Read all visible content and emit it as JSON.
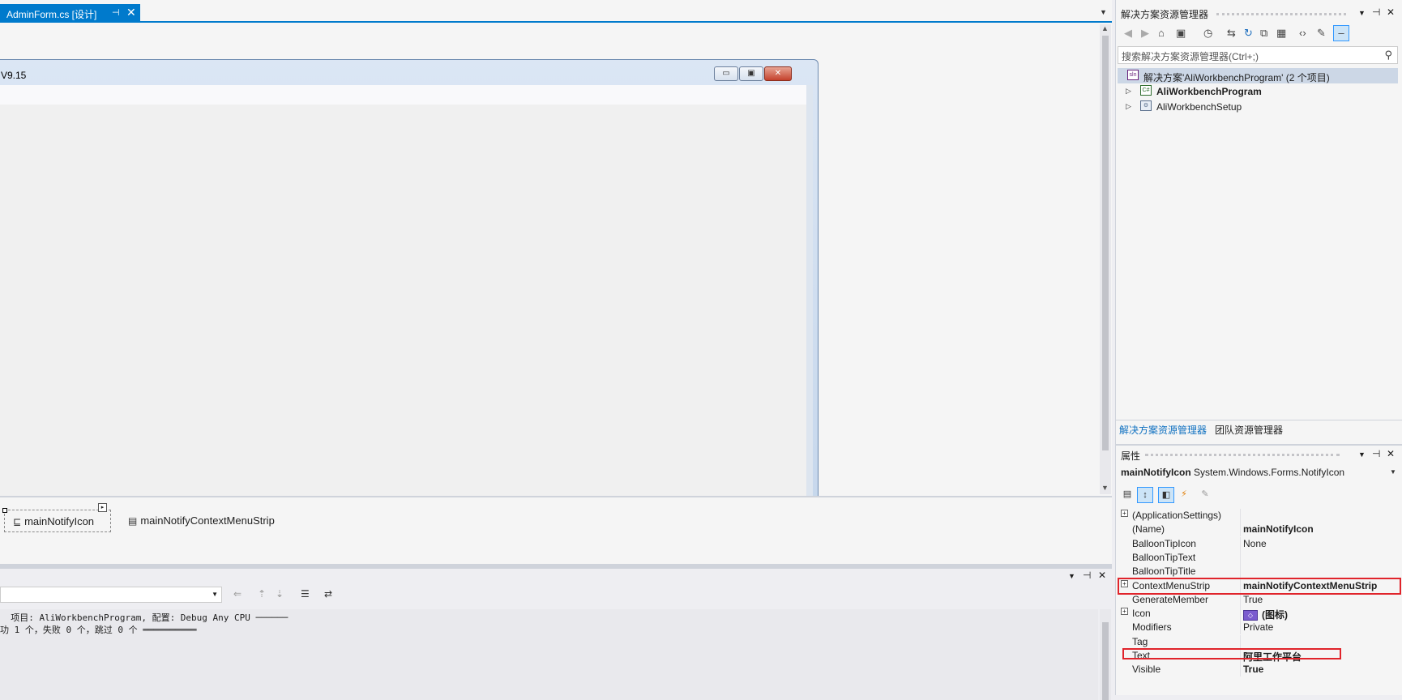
{
  "document_tab": {
    "title": "AdminForm.cs [设计]",
    "pin": "⊣",
    "close": "✕"
  },
  "form": {
    "title": "V9.15",
    "min": "▭",
    "max": "▣",
    "close": "✕"
  },
  "tray": {
    "items": [
      {
        "label": "mainNotifyIcon",
        "icon": "notify-icon"
      },
      {
        "label": "mainNotifyContextMenuStrip",
        "icon": "context-menu-icon"
      }
    ]
  },
  "output": {
    "combo_value": "",
    "lines": [
      "  项目: AliWorkbenchProgram, 配置: Debug Any CPU ──────",
      "功 1 个，失败 0 个，跳过 0 个 ══════════"
    ]
  },
  "solution_explorer": {
    "title": "解决方案资源管理器",
    "search_placeholder": "搜索解决方案资源管理器(Ctrl+;)",
    "tree": [
      {
        "label": "解决方案'AliWorkbenchProgram' (2 个项目)",
        "icon": "solution-icon",
        "icon_text": "sln"
      },
      {
        "label": "AliWorkbenchProgram",
        "icon": "csharp-project-icon",
        "icon_text": "C#"
      },
      {
        "label": "AliWorkbenchSetup",
        "icon": "setup-project-icon",
        "icon_text": "⚙"
      }
    ],
    "tabs": [
      "解决方案资源管理器",
      "团队资源管理器"
    ]
  },
  "properties": {
    "title": "属性",
    "object_name": "mainNotifyIcon",
    "object_type": "System.Windows.Forms.NotifyIcon",
    "rows": [
      {
        "name": "(ApplicationSettings)",
        "value": "",
        "expandable": true,
        "bold": false
      },
      {
        "name": "(Name)",
        "value": "mainNotifyIcon",
        "expandable": false,
        "bold": true
      },
      {
        "name": "BalloonTipIcon",
        "value": "None",
        "expandable": false,
        "bold": false
      },
      {
        "name": "BalloonTipText",
        "value": "",
        "expandable": false,
        "bold": false
      },
      {
        "name": "BalloonTipTitle",
        "value": "",
        "expandable": false,
        "bold": false
      },
      {
        "name": "ContextMenuStrip",
        "value": "mainNotifyContextMenuStrip",
        "expandable": true,
        "bold": true
      },
      {
        "name": "GenerateMember",
        "value": "True",
        "expandable": false,
        "bold": false
      },
      {
        "name": "Icon",
        "value": "(图标)",
        "expandable": true,
        "bold": true
      },
      {
        "name": "Modifiers",
        "value": "Private",
        "expandable": false,
        "bold": false
      },
      {
        "name": "Tag",
        "value": "",
        "expandable": false,
        "bold": false
      },
      {
        "name": "Text",
        "value": "阿里工作平台",
        "expandable": false,
        "bold": true
      },
      {
        "name": "Visible",
        "value": "True",
        "expandable": false,
        "bold": true
      }
    ],
    "highlight_color": "#e0242b"
  }
}
